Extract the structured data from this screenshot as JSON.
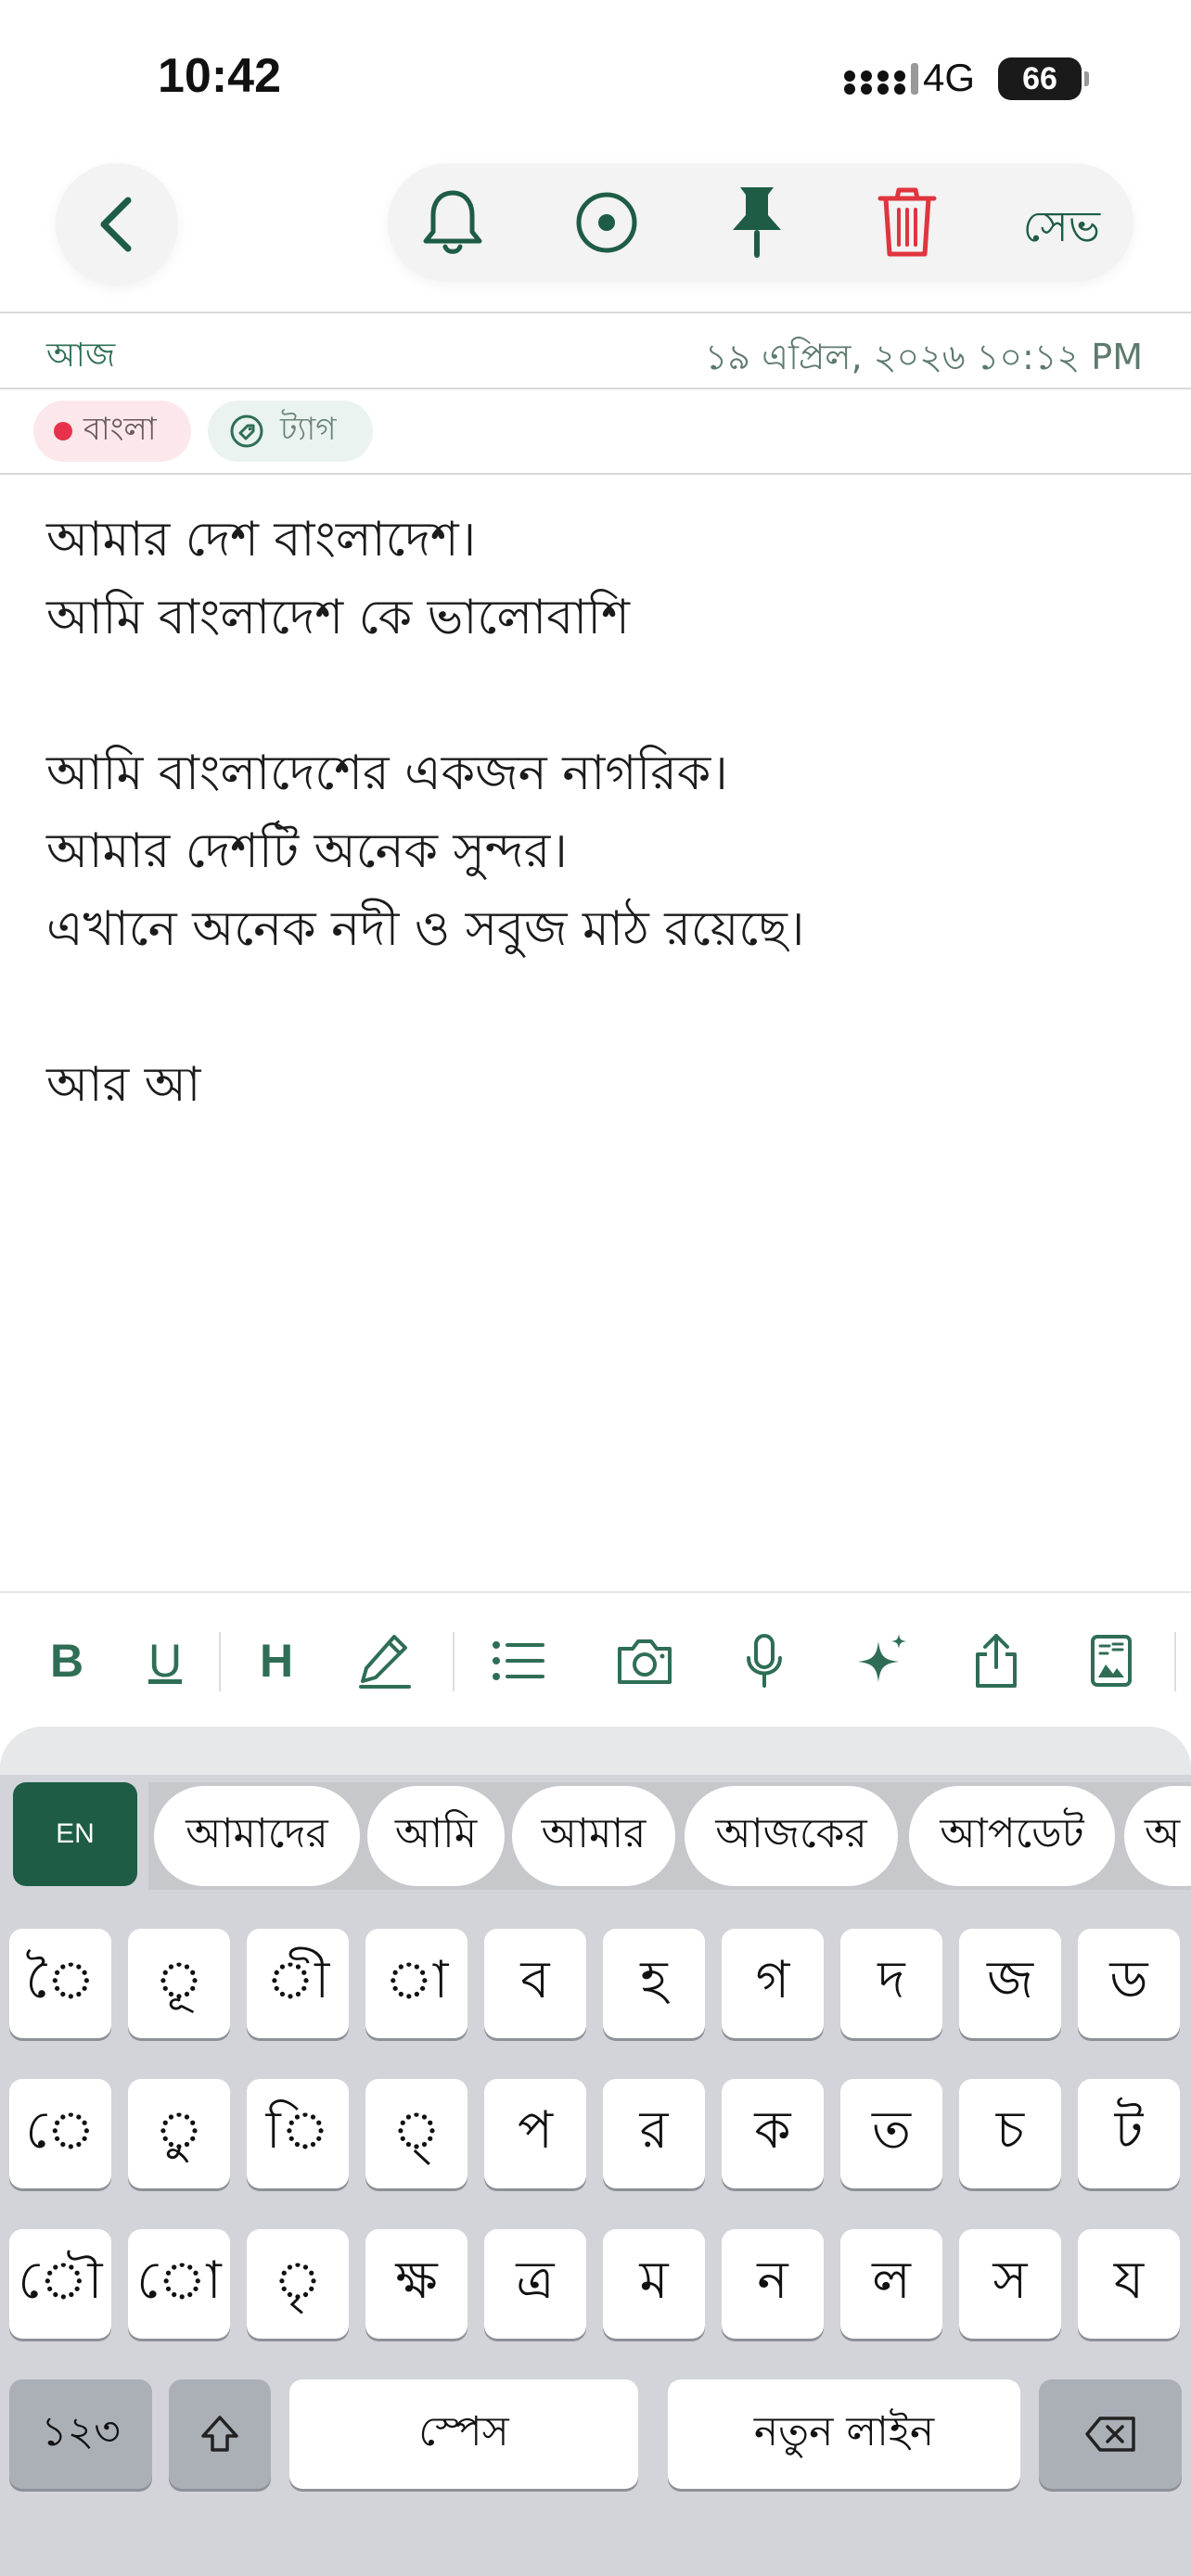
{
  "status_bar": {
    "time": "10:42",
    "network": "4G",
    "battery": "66"
  },
  "header": {
    "save_label": "সেভ"
  },
  "meta": {
    "day": "আজ",
    "datetime": "১৯ এপ্রিল, ২০২৬ ১০:১২ PM"
  },
  "chips": {
    "language": "বাংলা",
    "tag": "ট্যাগ"
  },
  "note": {
    "lines": [
      "আমার দেশ বাংলাদেশ।",
      "আমি বাংলাদেশ কে ভালোবাশি",
      "",
      "আমি বাংলাদেশের একজন নাগরিক।",
      "আমার দেশটি অনেক সুন্দর।",
      "এখানে অনেক নদী ও সবুজ মাঠ রয়েছে।",
      "",
      "আর আ"
    ]
  },
  "format_bar": {
    "bold": "B",
    "underline": "U",
    "heading": "H"
  },
  "keyboard": {
    "lang": "EN",
    "suggestions": [
      "আমাদের",
      "আমি",
      "আমার",
      "আজকের",
      "আপডেট",
      "অ"
    ],
    "row1": [
      "ৈ",
      "ূ",
      "ী",
      "া",
      "ব",
      "হ",
      "গ",
      "দ",
      "জ",
      "ড"
    ],
    "row2": [
      "ে",
      "ু",
      "ি",
      "্",
      "প",
      "র",
      "ক",
      "ত",
      "চ",
      "ট"
    ],
    "row3": [
      "ৌ",
      "ো",
      "ৃ",
      "ক্ষ",
      "ত্র",
      "ম",
      "ন",
      "ল",
      "স",
      "য"
    ],
    "numbers": "১২৩",
    "space": "স্পেস",
    "newline": "নতুন লাইন"
  },
  "colors": {
    "accent": "#1e5c46",
    "delete": "#e0353f",
    "keyboard_bg": "#d2d4d9"
  }
}
